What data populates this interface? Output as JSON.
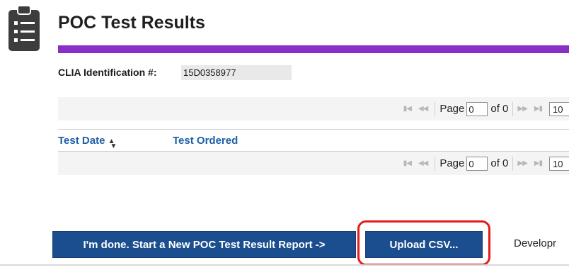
{
  "header": {
    "title": "POC Test Results",
    "icon": "clipboard-list-icon"
  },
  "accent_color": "#8a2fc6",
  "clia": {
    "label": "CLIA Identification #:",
    "value": "15D0358977"
  },
  "pager": {
    "page_label": "Page",
    "page_value": "0",
    "of_label": "of 0",
    "page_size": "10"
  },
  "table": {
    "columns": [
      {
        "label": "Test Date",
        "sort_icon": "sort-icon"
      },
      {
        "label": "Test Ordered"
      }
    ]
  },
  "actions": {
    "new_report_label": "I'm done.  Start a New POC Test Result Report ->",
    "upload_label": "Upload CSV...",
    "upload_highlight_color": "#e31b1b"
  },
  "footer": {
    "text": "Developr"
  }
}
